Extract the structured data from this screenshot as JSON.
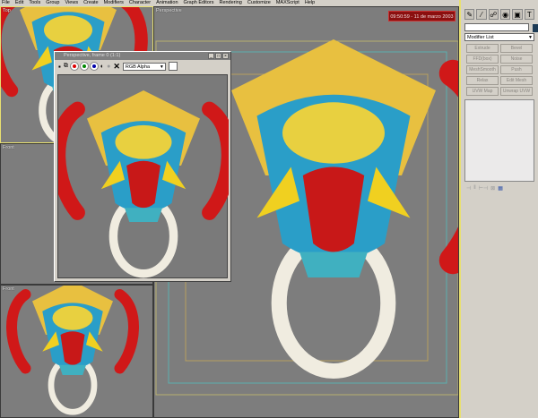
{
  "menu": [
    "File",
    "Edit",
    "Tools",
    "Group",
    "Views",
    "Create",
    "Modifiers",
    "Character",
    "Animation",
    "Graph Editors",
    "Rendering",
    "Customize",
    "MAXScript",
    "Help"
  ],
  "viewports": {
    "top": "Top",
    "front": "Front",
    "left": "Front",
    "perspective": "Perspective"
  },
  "clock": "09:50:59 - 11 de marzo 2003",
  "panel": {
    "tabs": [
      "create-icon",
      "modify-icon",
      "hierarchy-icon",
      "motion-icon",
      "display-icon",
      "utilities-icon"
    ],
    "modifier_list": "Modifier List",
    "buttons": [
      "Extrude",
      "Bevel",
      "FFD(box)",
      "Noise",
      "MeshSmooth",
      "Push",
      "Relax",
      "Edit Mesh",
      "UVW Map",
      "Unwrap UVW"
    ],
    "swatch_color": "#1d3b55"
  },
  "frame_window": {
    "title": "Perspective, frame 0 (1:1)",
    "channel": "RGB Alpha"
  }
}
